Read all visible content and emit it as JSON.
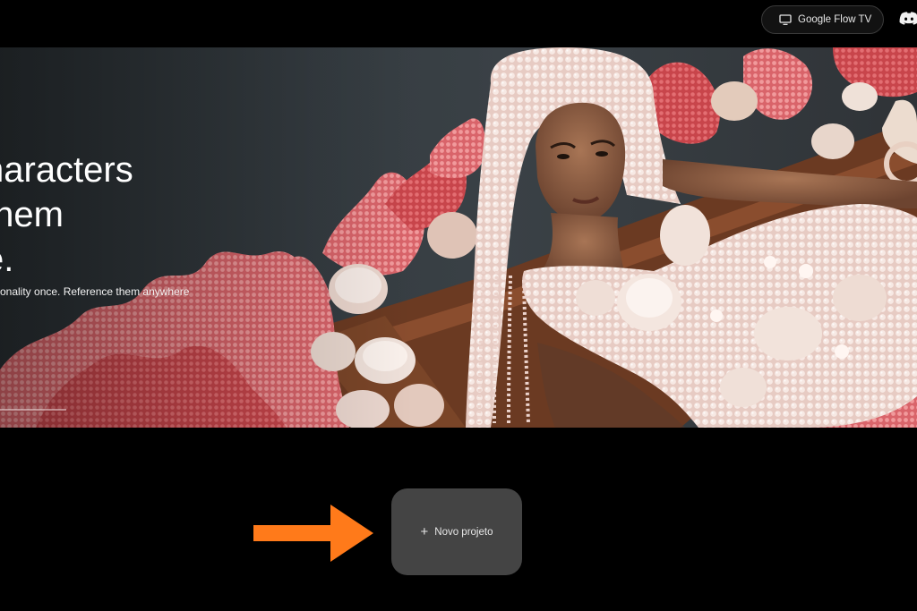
{
  "header": {
    "flow_tv_label": "Google Flow TV",
    "icons": {
      "tv": "tv-icon",
      "discord": "discord-icon"
    }
  },
  "hero": {
    "title_lines": [
      "haracters",
      "them",
      "e."
    ],
    "subtitle": "rsonality once. Reference them anywhere",
    "image_description": "woman in pearl and shell dress surrounded by pink coral"
  },
  "main": {
    "new_project_label": "Novo projeto",
    "new_project_icon": "plus-icon"
  },
  "annotation": {
    "arrow_color": "#ff7a1a"
  },
  "colors": {
    "background": "#000000",
    "card": "#444444",
    "hero_bg": "#353c41",
    "coral": "#e8787c",
    "pearl": "#efd9d2"
  }
}
